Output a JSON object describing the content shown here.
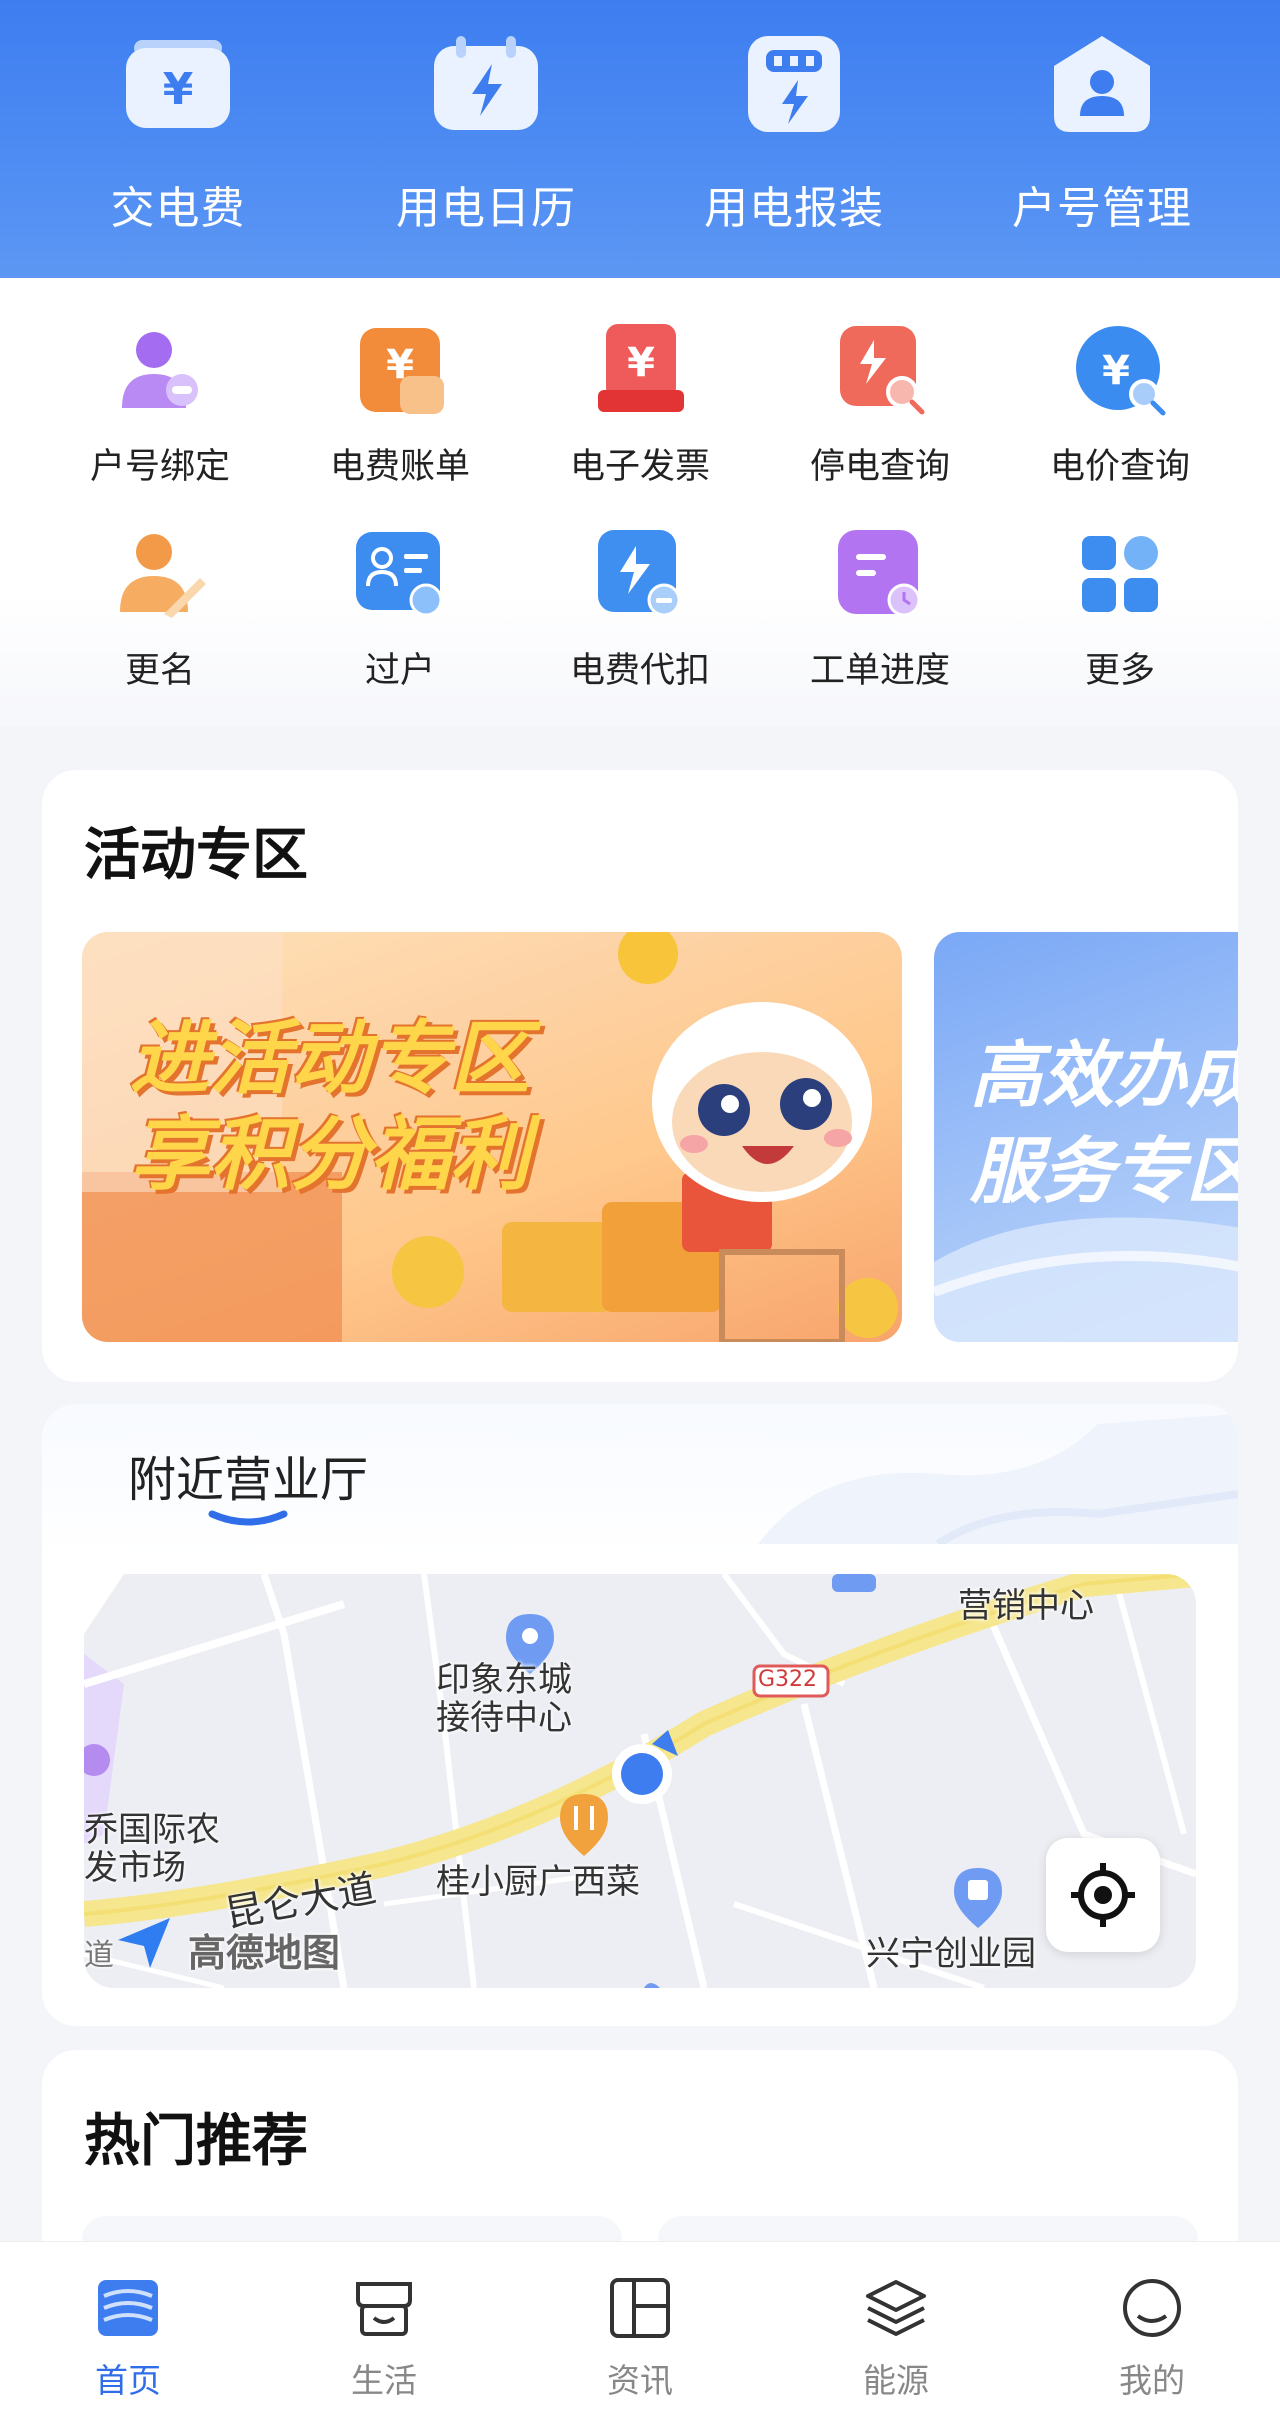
{
  "top_shortcuts": [
    {
      "label": "交电费",
      "icon": "yuan-card-icon"
    },
    {
      "label": "用电日历",
      "icon": "calendar-lightning-icon"
    },
    {
      "label": "用电报装",
      "icon": "meter-lightning-icon"
    },
    {
      "label": "户号管理",
      "icon": "house-user-icon"
    }
  ],
  "services": [
    {
      "label": "户号绑定",
      "icon": "user-bind-icon",
      "color": "#a46cf0"
    },
    {
      "label": "电费账单",
      "icon": "bill-icon",
      "color": "#f28c3a"
    },
    {
      "label": "电子发票",
      "icon": "invoice-icon",
      "color": "#e64646"
    },
    {
      "label": "停电查询",
      "icon": "outage-search-icon",
      "color": "#ef6a5a"
    },
    {
      "label": "电价查询",
      "icon": "price-search-icon",
      "color": "#3b8cf0"
    },
    {
      "label": "更名",
      "icon": "rename-icon",
      "color": "#f39a48"
    },
    {
      "label": "过户",
      "icon": "transfer-icon",
      "color": "#3d8cf0"
    },
    {
      "label": "电费代扣",
      "icon": "auto-debit-icon",
      "color": "#3f8ff0"
    },
    {
      "label": "工单进度",
      "icon": "work-order-icon",
      "color": "#b274f0"
    },
    {
      "label": "更多",
      "icon": "more-grid-icon",
      "color": "#3d8cf0"
    }
  ],
  "activity": {
    "title": "活动专区",
    "banner1_line1": "进活动专区",
    "banner1_line2": "享积分福利",
    "banner2_line1": "高效办成",
    "banner2_line2": "服务专区"
  },
  "nearby": {
    "tab": "附近营业厅",
    "map_labels": {
      "sales_center": "营销中心",
      "reception_line1": "印象东城",
      "reception_line2": "接待中心",
      "road_tag": "G322",
      "market_line1": "乔国际农",
      "market_line2": "发市场",
      "road_name": "昆仑大道",
      "restaurant": "桂小厨广西菜",
      "park": "兴宁创业园",
      "map_brand": "高德地图",
      "edge_text": "道"
    }
  },
  "hot": {
    "title": "热门推荐"
  },
  "bottom_nav": [
    {
      "label": "首页",
      "icon": "home-icon",
      "active": true
    },
    {
      "label": "生活",
      "icon": "store-icon",
      "active": false
    },
    {
      "label": "资讯",
      "icon": "news-icon",
      "active": false
    },
    {
      "label": "能源",
      "icon": "layers-icon",
      "active": false
    },
    {
      "label": "我的",
      "icon": "profile-icon",
      "active": false
    }
  ],
  "colors": {
    "brand_blue": "#3d7df0",
    "active_nav": "#2f6ee8"
  }
}
